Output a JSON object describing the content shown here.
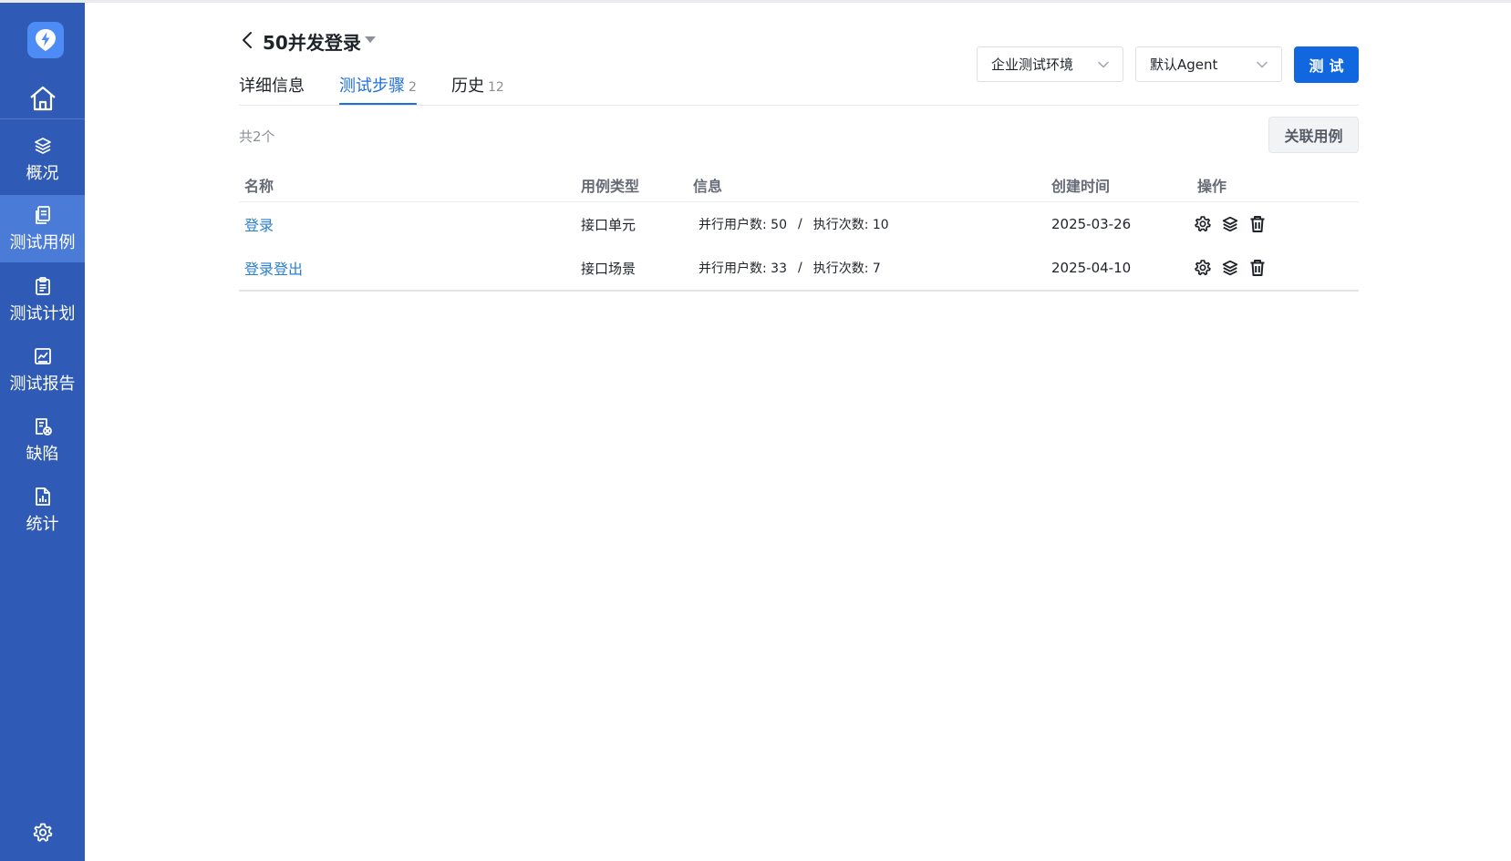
{
  "sidebar": {
    "logo": "lightning-logo",
    "home_icon": "home-icon",
    "items": [
      {
        "label": "概况",
        "icon": "layers-icon"
      },
      {
        "label": "测试用例",
        "icon": "document-icon",
        "active": true
      },
      {
        "label": "测试计划",
        "icon": "clipboard-icon"
      },
      {
        "label": "测试报告",
        "icon": "report-chart-icon"
      },
      {
        "label": "缺陷",
        "icon": "bug-document-icon"
      },
      {
        "label": "统计",
        "icon": "bar-chart-icon"
      }
    ],
    "settings_icon": "gear-icon"
  },
  "header": {
    "title": "50并发登录",
    "tabs": [
      {
        "label": "详细信息",
        "count": ""
      },
      {
        "label": "测试步骤",
        "count": "2",
        "active": true
      },
      {
        "label": "历史",
        "count": "12"
      }
    ],
    "environment_select": "企业测试环境",
    "agent_select": "默认Agent",
    "test_button": "测试"
  },
  "toolbar": {
    "total": "共2个",
    "link_button": "关联用例"
  },
  "table": {
    "columns": [
      "名称",
      "用例类型",
      "信息",
      "创建时间",
      "操作"
    ],
    "rows": [
      {
        "name": "登录",
        "type": "接口单元",
        "users": "并行用户数: 50",
        "runs": "执行次数: 10",
        "created": "2025-03-26"
      },
      {
        "name": "登录登出",
        "type": "接口场景",
        "users": "并行用户数: 33",
        "runs": "执行次数: 7",
        "created": "2025-04-10"
      }
    ],
    "separator": "/",
    "row_actions": [
      "gear-icon",
      "layers-icon",
      "trash-icon"
    ]
  },
  "colors": {
    "sidebar": "#2f5bb6",
    "sidebar_active": "#4a7bd6",
    "primary": "#1067e0",
    "link": "#2b7ed8"
  }
}
